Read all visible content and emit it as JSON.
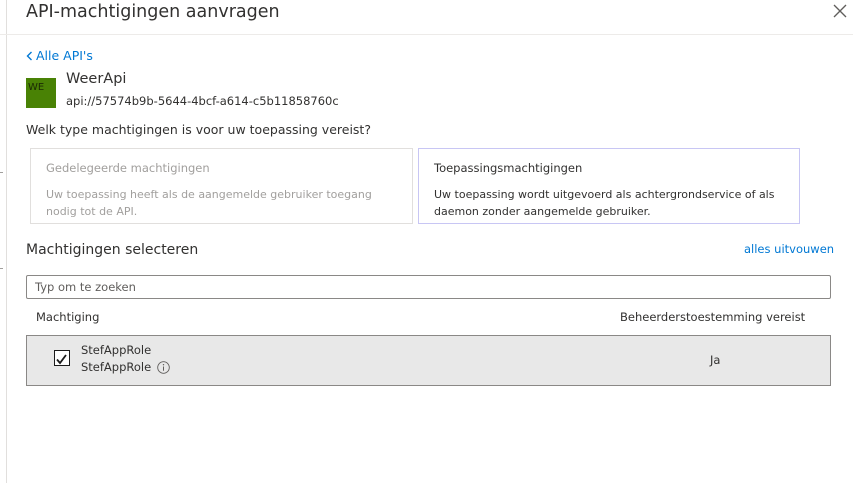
{
  "header": {
    "title": "API-machtigingen aanvragen",
    "close_icon": "close-icon"
  },
  "nav": {
    "back_label": "Alle API's",
    "back_icon": "chevron-left-icon"
  },
  "api": {
    "icon_text": "WE",
    "icon_color": "#498205",
    "name": "WeerApi",
    "id": "api://57574b9b-5644-4bcf-a614-c5b11858760c"
  },
  "permission_type": {
    "question": "Welk type machtigingen is voor uw toepassing vereist?",
    "options": [
      {
        "title": "Gedelegeerde machtigingen",
        "description": "Uw toepassing heeft als de aangemelde gebruiker toegang nodig tot de API.",
        "selected": false
      },
      {
        "title": "Toepassingsmachtigingen",
        "description": "Uw toepassing wordt uitgevoerd als achtergrondservice of als daemon zonder aangemelde gebruiker.",
        "selected": true
      }
    ]
  },
  "permissions": {
    "section_title": "Machtigingen selecteren",
    "expand_all": "alles uitvouwen",
    "search_placeholder": "Typ om te zoeken",
    "search_value": "",
    "columns": [
      "Machtiging",
      "Beheerderstoestemming vereist"
    ],
    "rows": [
      {
        "name": "StefAppRole",
        "description": "StefAppRole",
        "admin_consent": "Ja",
        "checked": true,
        "info_icon": "info-icon"
      }
    ]
  },
  "colors": {
    "accent": "#0078d4",
    "selected_row": "#e8e8e8"
  }
}
